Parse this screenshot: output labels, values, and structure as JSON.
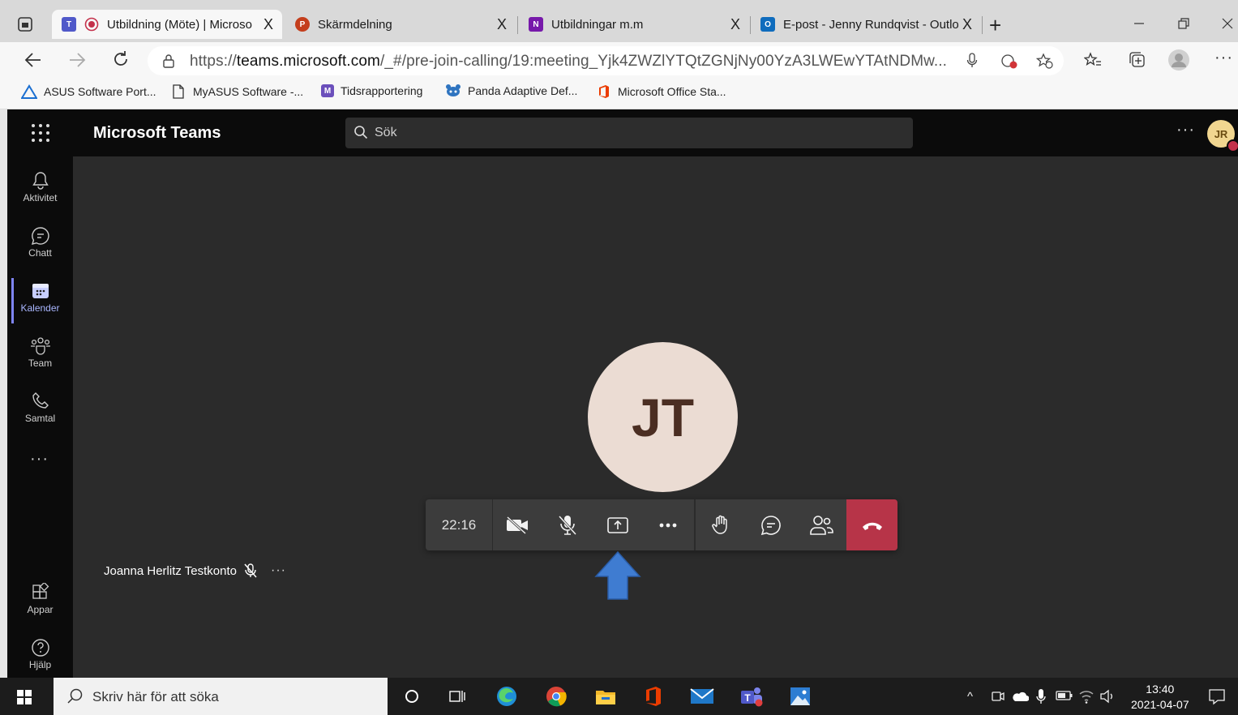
{
  "browser": {
    "tabs": [
      {
        "title": "Utbildning (Möte) | Microso",
        "close": "X",
        "active": true,
        "icon": "teams-icon"
      },
      {
        "title": "Skärmdelning",
        "close": "X",
        "icon": "powerpoint-icon"
      },
      {
        "title": "Utbildningar m.m",
        "close": "X",
        "icon": "onenote-icon"
      },
      {
        "title": "E-post - Jenny Rundqvist - Outlo",
        "close": "X",
        "icon": "outlook-icon"
      }
    ],
    "address": {
      "scheme": "https://",
      "host": "teams.microsoft.com",
      "path": "/_#/pre-join-calling/19:meeting_Yjk4ZWZlYTQtZGNjNy00YzA3LWEwYTAtNDMw..."
    },
    "bookmarks": [
      "ASUS Software Port...",
      "MyASUS Software -...",
      "Tidsrapportering",
      "Panda Adaptive Def...",
      "Microsoft Office Sta..."
    ]
  },
  "teams": {
    "app_title": "Microsoft Teams",
    "search_label": "Sök",
    "user_initials": "JR",
    "rail": [
      {
        "label": "Aktivitet",
        "icon": "bell-icon"
      },
      {
        "label": "Chatt",
        "icon": "chat-icon"
      },
      {
        "label": "Kalender",
        "icon": "calendar-icon",
        "active": true
      },
      {
        "label": "Team",
        "icon": "team-icon"
      },
      {
        "label": "Samtal",
        "icon": "phone-icon"
      }
    ],
    "rail_bottom": [
      {
        "label": "Appar",
        "icon": "apps-icon"
      },
      {
        "label": "Hjälp",
        "icon": "help-icon"
      }
    ],
    "call": {
      "avatar_initials": "JT",
      "timer": "22:16",
      "participant_name": "Joanna Herlitz Testkonto",
      "hangup_color": "#b73448",
      "highlight_arrow_color": "#3f7cd1"
    }
  },
  "taskbar": {
    "search_placeholder": "Skriv här för att söka",
    "time": "13:40",
    "date": "2021-04-07"
  }
}
